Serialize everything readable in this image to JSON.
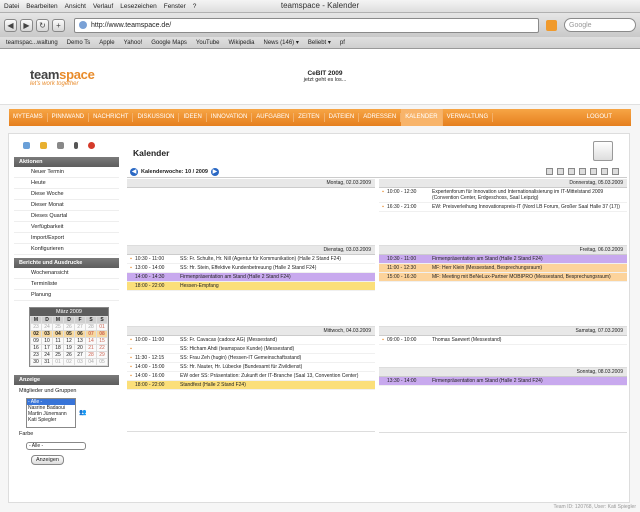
{
  "menubar": [
    "Datei",
    "Bearbeiten",
    "Ansicht",
    "Verlauf",
    "Lesezeichen",
    "Fenster",
    "?"
  ],
  "window_title": "teamspace - Kalender",
  "url": "http://www.teamspace.de/",
  "search_placeholder": "Google",
  "bookmarks": [
    "teamspac...waltung",
    "Demo Ts",
    "Apple",
    "Yahoo!",
    "Google Maps",
    "YouTube",
    "Wikipedia",
    "News (146) ▾",
    "Beliebt ▾",
    "pf"
  ],
  "logo": {
    "a": "team",
    "b": "space",
    "tagline": "let's work together"
  },
  "cebit": {
    "title": "CeBIT 2009",
    "sub": "jetzt geht es los..."
  },
  "nav": [
    "MYTEAMS",
    "PINNWAND",
    "NACHRICHT",
    "DISKUSSION",
    "IDEEN",
    "INNOVATION",
    "AUFGABEN",
    "ZEITEN",
    "DATEIEN",
    "ADRESSEN",
    "KALENDER",
    "VERWALTUNG"
  ],
  "nav_active": "KALENDER",
  "logout": "LOGOUT",
  "sidebar": {
    "aktionen": "Aktionen",
    "actions": [
      "Neuer Termin",
      "Heute",
      "Diese Woche",
      "Dieser Monat",
      "Dieses Quartal",
      "Verfügbarkeit",
      "Import/Export",
      "Konfigurieren"
    ],
    "berichte": "Berichte und Ausdrucke",
    "reports": [
      "Wochenansicht",
      "Terminliste",
      "Planung"
    ],
    "month": "März 2009",
    "weekdays": [
      "M",
      "D",
      "M",
      "D",
      "F",
      "S",
      "S"
    ],
    "weeks": [
      [
        "23",
        "24",
        "25",
        "26",
        "27",
        "28",
        "01"
      ],
      [
        "02",
        "03",
        "04",
        "05",
        "06",
        "07",
        "08"
      ],
      [
        "09",
        "10",
        "11",
        "12",
        "13",
        "14",
        "15"
      ],
      [
        "16",
        "17",
        "18",
        "19",
        "20",
        "21",
        "22"
      ],
      [
        "23",
        "24",
        "25",
        "26",
        "27",
        "28",
        "29"
      ],
      [
        "30",
        "31",
        "01",
        "02",
        "03",
        "04",
        "05"
      ]
    ],
    "anzeige": "Anzeige",
    "mitglieder": "Mitglieder und Gruppen",
    "members": [
      "- Alle -",
      "Nasrine Badaoui",
      "Martin Jünemann",
      "Kati Spiegler"
    ],
    "farbe": "Farbe",
    "farbe_value": "- Alle -",
    "anzeigen": "Anzeigen"
  },
  "cal": {
    "title": "Kalender",
    "week": "Kalenderwoche: 10 / 2009",
    "days": {
      "mon": "Montag, 02.03.2009",
      "tue": "Dienstag, 03.03.2009",
      "wed": "Mittwoch, 04.03.2009",
      "thu": "Donnerstag, 05.03.2009",
      "fri": "Freitag, 06.03.2009",
      "sat": "Samstag, 07.03.2009",
      "sun": "Sonntag, 08.03.2009"
    },
    "tue": [
      {
        "t": "10:30 - 11:00",
        "x": "SS: Fr. Schulte, Hr. Nill (Agentur für Kommunikation) (Halle 2 Stand F24)",
        "c": ""
      },
      {
        "t": "13:00 - 14:00",
        "x": "SS: Hr. Stein, Effektive Kundenbetreuung (Halle 2 Stand F24)",
        "c": ""
      },
      {
        "t": "14:00 - 14:30",
        "x": "Firmenpräsentation am Stand (Halle 2 Stand F24)",
        "c": "p"
      },
      {
        "t": "18:00 - 22:00",
        "x": "Hessen-Empfang",
        "c": "y"
      }
    ],
    "wed": [
      {
        "t": "10:00 - 11:00",
        "x": "SS: Fr. Cavacas (cadooz AG) (Messestand)",
        "c": ""
      },
      {
        "t": "",
        "x": "SS: Hicham Ahdi (teamspace Kunde) (Messestand)",
        "c": ""
      },
      {
        "t": "11:30 - 12:15",
        "x": "SS: Frau Zeh (hugin) (Hessen-IT Gemeinschaftsstand)",
        "c": ""
      },
      {
        "t": "14:00 - 15:00",
        "x": "SS: Hr. Nauter, Hr. Lübecke (Bundesamt für Zivildienst)",
        "c": ""
      },
      {
        "t": "14:00 - 16:00",
        "x": "EW oder SS: Präsentation: Zukunft der IT-Branche (Saal 13, Convention Center)",
        "c": ""
      },
      {
        "t": "18:00 - 22:00",
        "x": "Standfest (Halle 2 Stand F24)",
        "c": "y"
      }
    ],
    "thu": [
      {
        "t": "10:00 - 12:30",
        "x": "Expertenforum für Innovation und Internationalisierung im IT-Mittelstand 2009 (Convention Center, Erdgeschoss, Saal Leipzig)",
        "c": ""
      },
      {
        "t": "16:30 - 21:00",
        "x": "EW: Preisverleihung Innovationspreis-IT (Nord LB Forum, Großer Saal Halle 37 (17))",
        "c": ""
      }
    ],
    "fri": [
      {
        "t": "10:30 - 11:00",
        "x": "Firmenpräsentation am Stand (Halle 2 Stand F24)",
        "c": "p"
      },
      {
        "t": "11:00 - 12:30",
        "x": "MF: Herr Klein (Messestand, Besprechungsraum)",
        "c": "o"
      },
      {
        "t": "15:00 - 16:30",
        "x": "MF: Meeting mit BeNeLux-Partner MOBIPRO (Messestand, Besprechungsraum)",
        "c": "o"
      }
    ],
    "sat": [
      {
        "t": "09:00 - 10:00",
        "x": "Thomas Saewert (Messestand)",
        "c": ""
      }
    ],
    "sun": [
      {
        "t": "13:30 - 14:00",
        "x": "Firmenpräsentation am Stand (Halle 2 Stand F24)",
        "c": "p"
      }
    ]
  },
  "footer": "Team ID: 120768, User: Kati Spiegler"
}
